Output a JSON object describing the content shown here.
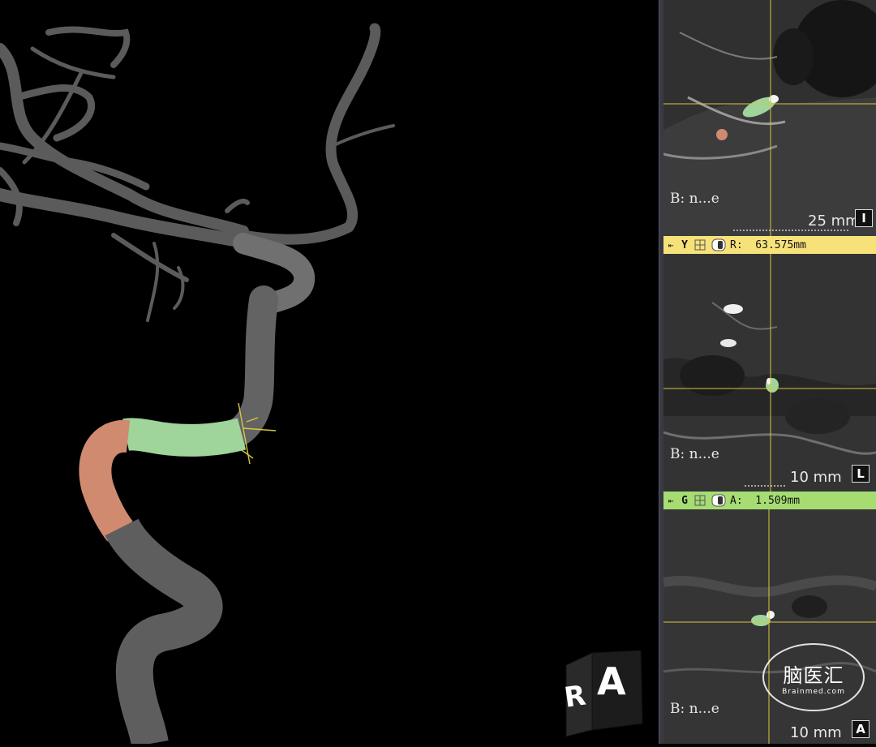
{
  "viewer": {
    "orientation_cube": {
      "face_left": "R",
      "face_front": "A"
    }
  },
  "panes": [
    {
      "label": "B: n...e",
      "scale_text": "25 mm",
      "orientation_icon": "I"
    },
    {
      "label": "B: n...e",
      "scale_text": "10 mm",
      "orientation_icon": "L"
    },
    {
      "label": "B: n...e",
      "scale_text": "10 mm",
      "orientation_icon": "A"
    }
  ],
  "toolbars": [
    {
      "arrow": "⇤",
      "letter": "Y",
      "coordinate": "R:  63.575mm",
      "color": "#f7e27a"
    },
    {
      "arrow": "⇤",
      "letter": "G",
      "coordinate": "A:  1.509mm",
      "color": "#a6dc72"
    }
  ],
  "watermark": {
    "text": "脑医汇",
    "subtext": "Brainmed.com"
  },
  "colors": {
    "vessel_gray": "#6d6d6d",
    "segment_green": "#9fd49a",
    "segment_orange": "#d08a70",
    "crosshair_yellow": "#d9c640"
  }
}
